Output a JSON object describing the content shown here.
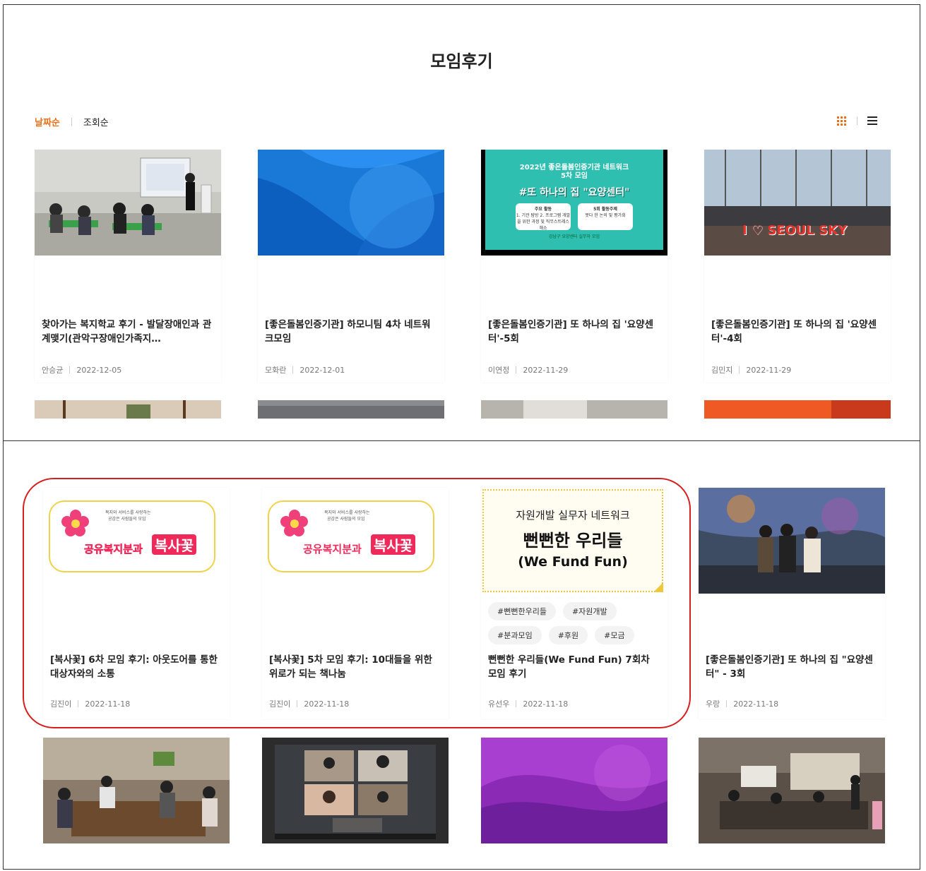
{
  "page": {
    "title": "모임후기",
    "sort": {
      "date": "날짜순",
      "views": "조회순"
    },
    "view_icons": [
      "grid-icon",
      "list-icon"
    ]
  },
  "colors": {
    "accent": "#e8711c",
    "highlight": "#d61f1f"
  },
  "top_cards": [
    {
      "title": "찾아가는 복지학교 후기 - 발달장애인과 관계맺기(관악구장애인가족지…",
      "author": "안승균",
      "date": "2022-12-05"
    },
    {
      "title": "[좋은돌봄인증기관] 하모니팀 4차 네트워크모임",
      "author": "모화란",
      "date": "2022-12-01"
    },
    {
      "title": "[좋은돌봄인증기관] 또 하나의 집 '요양센터'-5회",
      "author": "이연정",
      "date": "2022-11-29",
      "thumb": {
        "line1": "2022년 좋은돌봄인증기관 네트워크",
        "line2": "5차 모임",
        "headline": "#또 하나의 집 \"요양센터\"",
        "box1_title": "주요 활동",
        "box1_body": "1. 기관 탐방 2. 프로그램 개발을 위한 과정 및 직무스트레스 해소",
        "box2_title": "5회 활동주제",
        "box2_body": "못다 한 논의 및 평가회",
        "footer": "강남구 요양센터 실무자 모임"
      }
    },
    {
      "title": "[좋은돌봄인증기관] 또 하나의 집 '요양센터'-4회",
      "author": "김민지",
      "date": "2022-11-29",
      "thumb": {
        "sign": "I ♡ SEOUL SKY"
      }
    }
  ],
  "bottom_cards": [
    {
      "title": "[복사꽃] 6차 모임 후기: 아웃도어를 통한 대상자와의 소통",
      "author": "김진이",
      "date": "2022-11-18",
      "thumb": {
        "small1": "복지와 서비스를 사랑하는",
        "small2": "공감은 사람들의 모임",
        "logo_left": "공유복지분과",
        "logo_right": "복사꽃"
      }
    },
    {
      "title": "[복사꽃] 5차 모임 후기: 10대들을 위한 위로가 되는 책나눔",
      "author": "김진이",
      "date": "2022-11-18",
      "thumb": {
        "small1": "복지와 서비스를 사랑하는",
        "small2": "공감은 사람들의 모임",
        "logo_left": "공유복지분과",
        "logo_right": "복사꽃"
      }
    },
    {
      "title": "뻔뻔한 우리들(We Fund Fun) 7회차 모임 후기",
      "author": "유선우",
      "date": "2022-11-18",
      "thumb": {
        "line1": "자원개발 실무자 네트워크",
        "line2": "뻔뻔한 우리들",
        "line3": "(We Fund Fun)"
      },
      "tags": [
        "#뻔뻔한우리들",
        "#자원개발",
        "#분과모임",
        "#후원",
        "#모금"
      ]
    },
    {
      "title": "[좋은돌봄인증기관] 또 하나의 집 \"요양센터\" - 3회",
      "author": "우랑",
      "date": "2022-11-18"
    }
  ]
}
